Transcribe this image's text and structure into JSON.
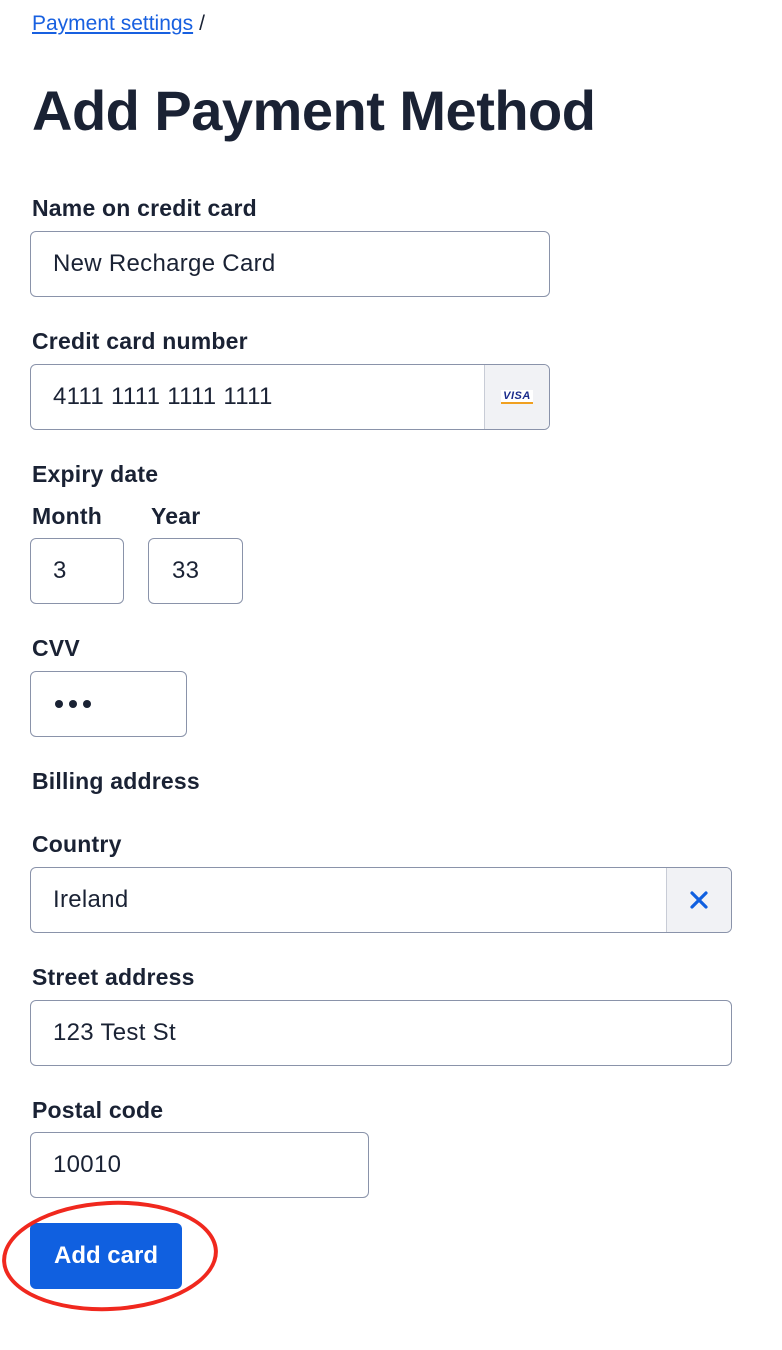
{
  "breadcrumb": {
    "link": "Payment settings",
    "separator": "/"
  },
  "page_title": "Add Payment Method",
  "form": {
    "name_label": "Name on credit card",
    "name_value": "New Recharge Card",
    "card_number_label": "Credit card number",
    "card_number_value": "4111 1111 1111 1111",
    "card_brand": "VISA",
    "expiry_label": "Expiry date",
    "month_label": "Month",
    "month_value": "3",
    "year_label": "Year",
    "year_value": "33",
    "cvv_label": "CVV",
    "billing_heading": "Billing address",
    "country_label": "Country",
    "country_value": "Ireland",
    "street_label": "Street address",
    "street_value": "123 Test St",
    "postal_label": "Postal code",
    "postal_value": "10010",
    "submit_label": "Add card"
  },
  "icons": {
    "card_brand_icon": "visa-icon",
    "clear_icon": "close-icon"
  },
  "colors": {
    "accent": "#1060e0",
    "link": "#1860e0",
    "highlight_circle": "#f0281e"
  }
}
